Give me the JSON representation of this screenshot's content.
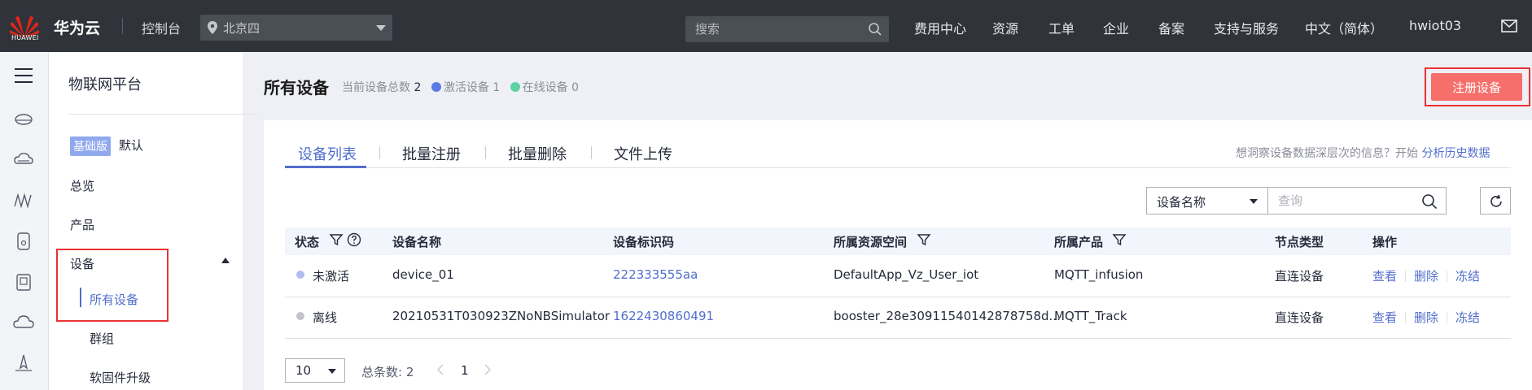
{
  "topbar": {
    "logo_text": "HUAWEI",
    "brand": "华为云",
    "console": "控制台",
    "region": "北京四",
    "search_placeholder": "搜索",
    "nav": [
      "费用中心",
      "资源",
      "工单",
      "企业",
      "备案",
      "支持与服务",
      "中文（简体）",
      "hwiot03"
    ],
    "icons": {
      "logo": "huawei-logo",
      "region": "location-pin-icon",
      "search": "search-icon",
      "mail": "mail-icon"
    }
  },
  "rail": {
    "icons": [
      "menu-icon",
      "database-icon",
      "cloud-server-icon",
      "network-icon",
      "device-icon",
      "tablet-icon",
      "cloud-icon",
      "compass-icon"
    ]
  },
  "sidebar": {
    "title": "物联网平台",
    "edition_badge": "基础版",
    "edition_default": "默认",
    "items": [
      "总览",
      "产品",
      "设备"
    ],
    "sub_items": [
      "所有设备",
      "群组",
      "软固件升级"
    ]
  },
  "main": {
    "title": "所有设备",
    "total_label": "当前设备总数",
    "total_value": "2",
    "active_label": "激活设备",
    "active_value": "1",
    "online_label": "在线设备",
    "online_value": "0",
    "register_button": "注册设备",
    "tabs": [
      "设备列表",
      "批量注册",
      "批量删除",
      "文件上传"
    ],
    "hint_text": "想洞察设备数据深层次的信息？开始",
    "hint_link": "分析历史数据",
    "filter_field": "设备名称",
    "query_placeholder": "查询",
    "colors": {
      "accent": "#526ecc",
      "register": "#f66f6a",
      "active_dot": "#5b7be6",
      "online_dot": "#5dd3a4"
    }
  },
  "table": {
    "headers": [
      "状态",
      "设备名称",
      "设备标识码",
      "所属资源空间",
      "所属产品",
      "节点类型",
      "操作"
    ],
    "rows": [
      {
        "status": "未激活",
        "name": "device_01",
        "id": "222333555aa",
        "space": "DefaultApp_Vz_User_iot",
        "product": "MQTT_infusion",
        "node": "直连设备",
        "ops": [
          "查看",
          "删除",
          "冻结"
        ],
        "dot": "#b0bcf0"
      },
      {
        "status": "离线",
        "name": "20210531T030923ZNoNBSimulator",
        "id": "1622430860491",
        "space": "booster_28e30911540142878758d...",
        "product": "MQTT_Track",
        "node": "直连设备",
        "ops": [
          "查看",
          "删除",
          "冻结"
        ],
        "dot": "#c2c4c9"
      }
    ]
  },
  "pager": {
    "size": "10",
    "total_label": "总条数: 2",
    "page": "1"
  }
}
